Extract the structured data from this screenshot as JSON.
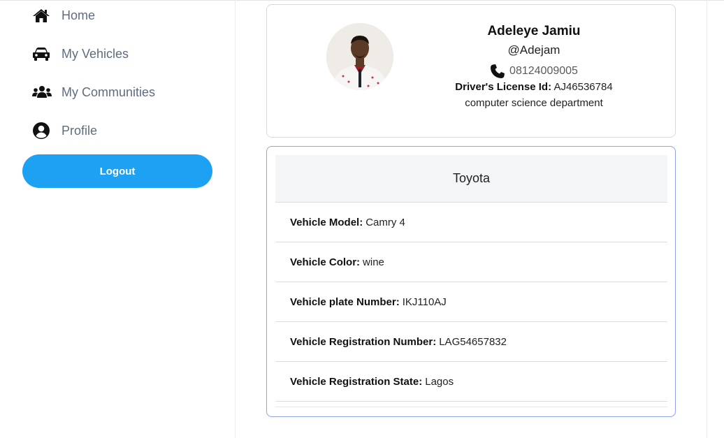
{
  "sidebar": {
    "items": [
      {
        "label": "Home",
        "icon": "home-icon"
      },
      {
        "label": "My Vehicles",
        "icon": "car-icon"
      },
      {
        "label": "My Communities",
        "icon": "users-icon"
      },
      {
        "label": "Profile",
        "icon": "user-circle-icon"
      }
    ],
    "logout_label": "Logout",
    "logout_color": "#1da1f2"
  },
  "profile": {
    "name": "Adeleye Jamiu",
    "handle": "@Adejam",
    "phone": "08124009005",
    "license_label": "Driver's License Id:",
    "license_id": "AJ46536784",
    "department": "computer science department"
  },
  "vehicle": {
    "make": "Toyota",
    "fields": [
      {
        "label": "Vehicle Model:",
        "value": "Camry 4"
      },
      {
        "label": "Vehicle Color:",
        "value": "wine"
      },
      {
        "label": "Vehicle plate Number:",
        "value": "IKJ110AJ"
      },
      {
        "label": "Vehicle Registration Number:",
        "value": "LAG54657832"
      },
      {
        "label": "Vehicle Registration State:",
        "value": "Lagos"
      }
    ]
  }
}
